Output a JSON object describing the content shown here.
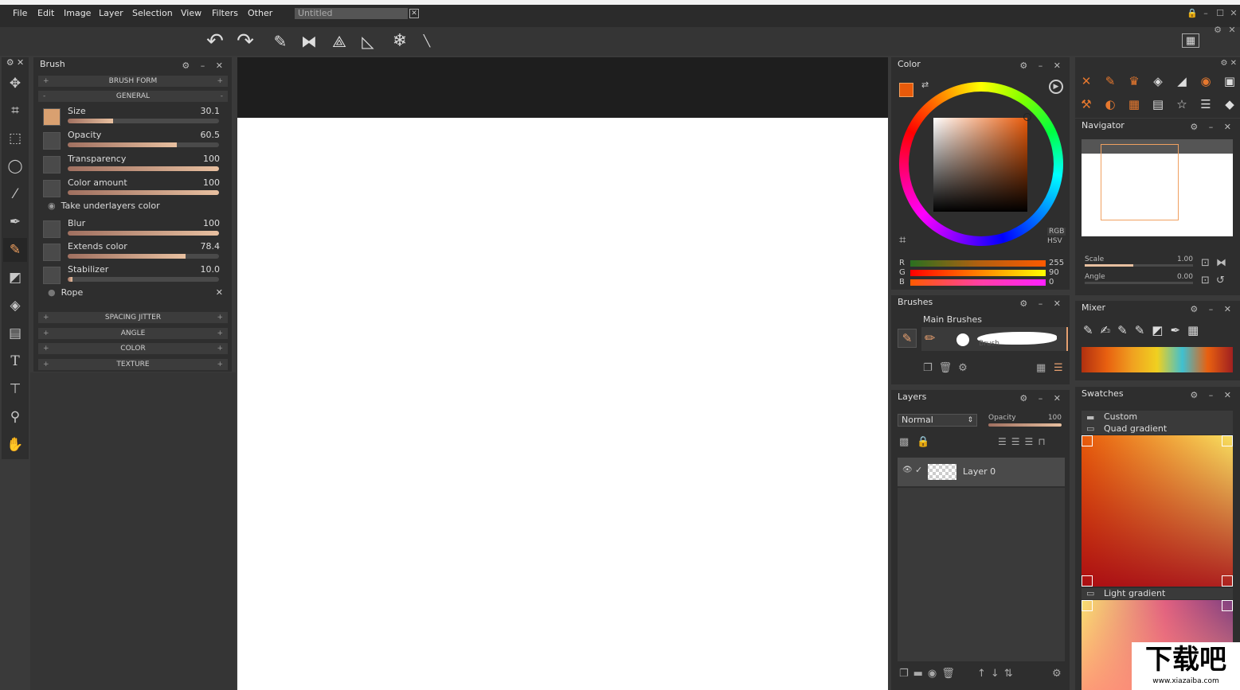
{
  "menu": {
    "items": [
      "File",
      "Edit",
      "Image",
      "Layer",
      "Selection",
      "View",
      "Filters",
      "Other"
    ],
    "doc_tab": "Untitled"
  },
  "brush_panel": {
    "title": "Brush",
    "sections_top": [
      "BRUSH FORM",
      "GENERAL"
    ],
    "sliders": [
      {
        "label": "Size",
        "value": "30.1",
        "fill": 0.3
      },
      {
        "label": "Opacity",
        "value": "60.5",
        "fill": 0.6
      },
      {
        "label": "Transparency",
        "value": "100",
        "fill": 1.0
      },
      {
        "label": "Color amount",
        "value": "100",
        "fill": 1.0
      },
      {
        "label": "Blur",
        "value": "100",
        "fill": 1.0
      },
      {
        "label": "Extends color",
        "value": "78.4",
        "fill": 0.78
      },
      {
        "label": "Stabilizer",
        "value": "10.0",
        "fill": 0.02
      }
    ],
    "take_underlayers": "Take underlayers color",
    "rope": "Rope",
    "sections_bottom": [
      "SPACING JITTER",
      "ANGLE",
      "COLOR",
      "TEXTURE"
    ]
  },
  "color_panel": {
    "title": "Color",
    "mode_rgb": "RGB",
    "mode_hsv": "HSV",
    "r_label": "R",
    "g_label": "G",
    "b_label": "B",
    "r": "255",
    "g": "90",
    "b": "0",
    "primary": "#e85a0a"
  },
  "brushes_panel": {
    "title": "Brushes",
    "group": "Main Brushes",
    "brush_label": "Brush"
  },
  "layers_panel": {
    "title": "Layers",
    "blend": "Normal",
    "opacity_label": "Opacity",
    "opacity_value": "100",
    "layer_name": "Layer 0"
  },
  "navigator": {
    "title": "Navigator",
    "scale_label": "Scale",
    "scale_value": "1.00",
    "angle_label": "Angle",
    "angle_value": "0.00"
  },
  "mixer": {
    "title": "Mixer"
  },
  "swatches": {
    "title": "Swatches",
    "custom": "Custom",
    "quad": "Quad gradient",
    "light": "Light gradient"
  },
  "watermark": {
    "big": "下载吧",
    "url": "www.xiazaiba.com"
  }
}
